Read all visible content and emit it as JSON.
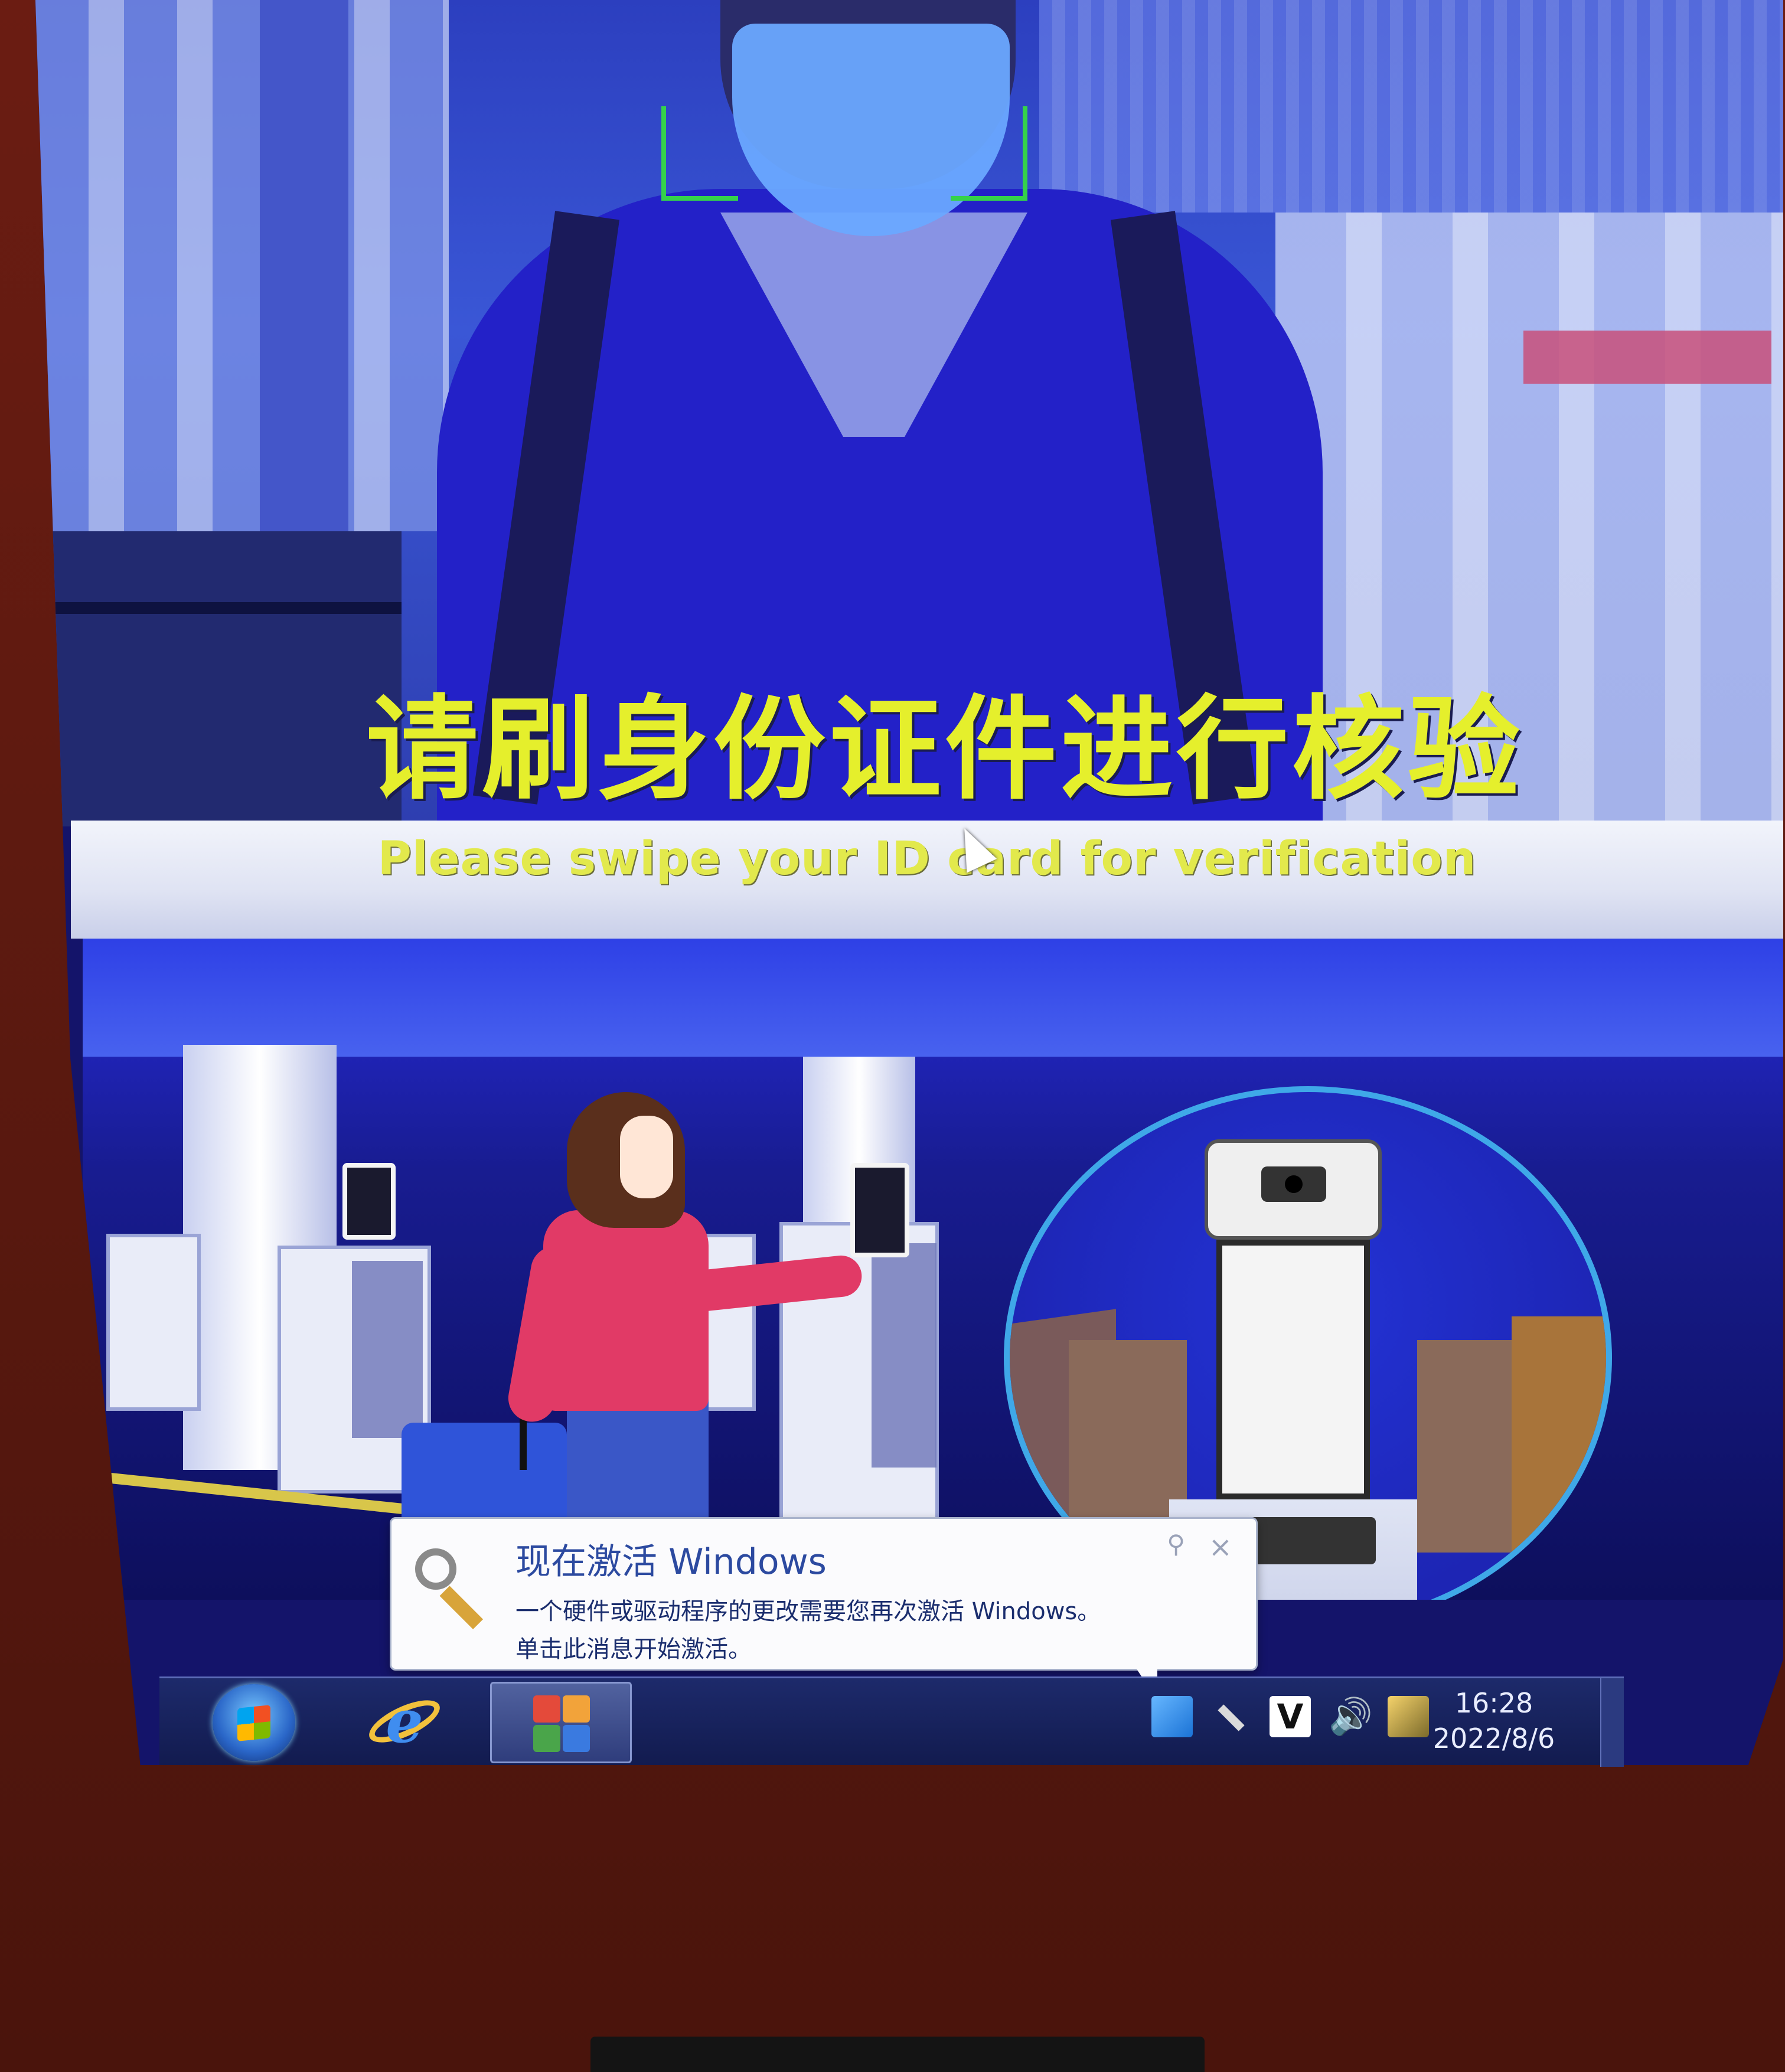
{
  "prompt": {
    "title_zh": "请刷身份证件进行核验",
    "subtitle_en": "Please swipe your ID card for verification"
  },
  "activation_balloon": {
    "title": "现在激活 Windows",
    "line1": "一个硬件或驱动程序的更改需要您再次激活 Windows。",
    "line2": "单击此消息开始激活。",
    "close_glyph": "×",
    "options_glyph": "⚲"
  },
  "taskbar": {
    "start_label": "Start",
    "ie_label": "e",
    "tray": {
      "v_icon_label": "V",
      "volume_glyph": "🔊",
      "time": "16:28",
      "date": "2022/8/6"
    }
  },
  "colors": {
    "prompt_text": "#e5ef2c",
    "face_box": "#35d24b",
    "kiosk_frame": "#5e1a10",
    "taskbar": "#121b4f"
  },
  "icons": [
    "start-orb-icon",
    "internet-explorer-icon",
    "office-app-icon",
    "action-center-flag-icon",
    "key-icon",
    "v-app-icon",
    "volume-icon",
    "network-icon",
    "activation-key-icon"
  ]
}
